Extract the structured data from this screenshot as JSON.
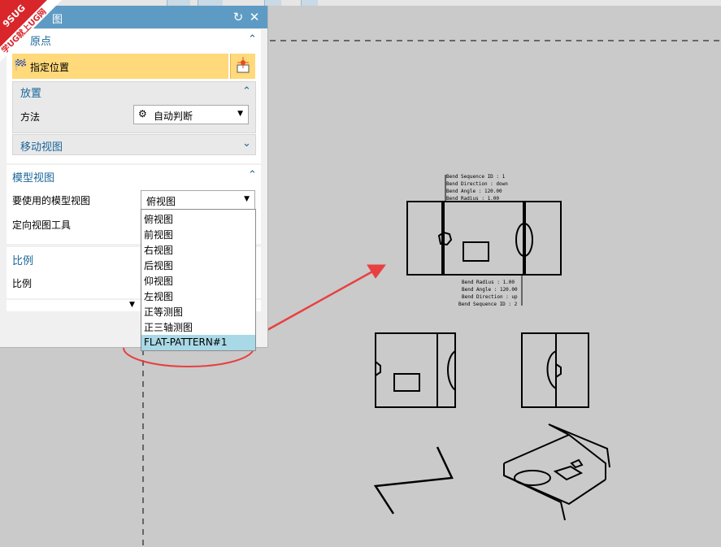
{
  "window": {
    "title_fragment": "图"
  },
  "badge": {
    "line1": "9SUG",
    "line2": "学UG就上UG网"
  },
  "sections": {
    "origin": {
      "title": "原点",
      "specify_location": "指定位置"
    },
    "placement": {
      "title": "放置",
      "method_label": "方法",
      "method_value": "自动判断"
    },
    "move_view": {
      "title": "移动视图"
    },
    "model_view": {
      "title": "模型视图",
      "use_label": "要使用的模型视图",
      "use_value": "俯视图",
      "orient_label": "定向视图工具",
      "options": [
        "俯视图",
        "前视图",
        "右视图",
        "后视图",
        "仰视图",
        "左视图",
        "正等测图",
        "正三轴测图",
        "FLAT-PATTERN#1"
      ],
      "highlighted_option": "FLAT-PATTERN#1"
    },
    "scale": {
      "title": "比例",
      "scale_label": "比例"
    }
  },
  "drawing": {
    "top_notes": [
      "Bend Sequence ID : 1",
      "Bend Direction : down",
      "Bend Angle : 120.00",
      "Bend Radius : 1.00"
    ],
    "bottom_notes": [
      "Bend Radius : 1.00",
      "Bend Angle : 120.00",
      "Bend Direction : up",
      "Bend Sequence ID : 2"
    ]
  },
  "colors": {
    "titlebar": "#5e9bc4",
    "section_text": "#1a6699",
    "highlight": "#ffd97a",
    "dropdown_highlight": "#a9d8e6",
    "annotation": "#e84040",
    "canvas": "#cacaca"
  }
}
